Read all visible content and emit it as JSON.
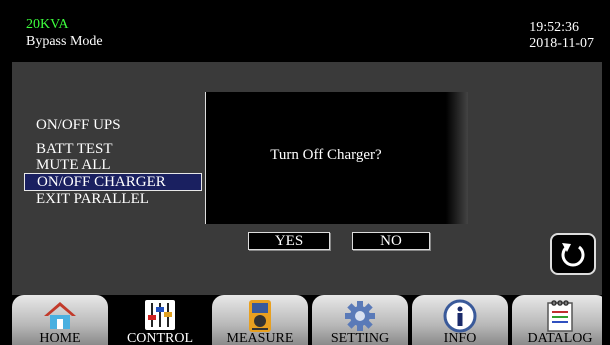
{
  "header": {
    "model": "20KVA",
    "mode": "Bypass Mode",
    "time": "19:52:36",
    "date": "2018-11-07"
  },
  "menu": {
    "items": [
      {
        "label": "ON/OFF UPS"
      },
      {
        "label": "BATT TEST"
      },
      {
        "label": "MUTE ALL"
      },
      {
        "label": "ON/OFF CHARGER",
        "selected": true
      },
      {
        "label": "EXIT PARALLEL"
      }
    ]
  },
  "dialog": {
    "message": "Turn Off Charger?",
    "yes_label": "YES",
    "no_label": "NO"
  },
  "tabs": [
    {
      "label": "HOME",
      "icon": "house-icon"
    },
    {
      "label": "CONTROL",
      "icon": "sliders-icon",
      "active": true
    },
    {
      "label": "MEASURE",
      "icon": "meter-icon"
    },
    {
      "label": "SETTING",
      "icon": "gear-icon"
    },
    {
      "label": "INFO",
      "icon": "info-icon"
    },
    {
      "label": "DATALOG",
      "icon": "notepad-icon"
    }
  ],
  "colors": {
    "model_text": "#3dff3d",
    "selected_bg": "#1a2060",
    "panel_bg": "#3a3a3a"
  }
}
